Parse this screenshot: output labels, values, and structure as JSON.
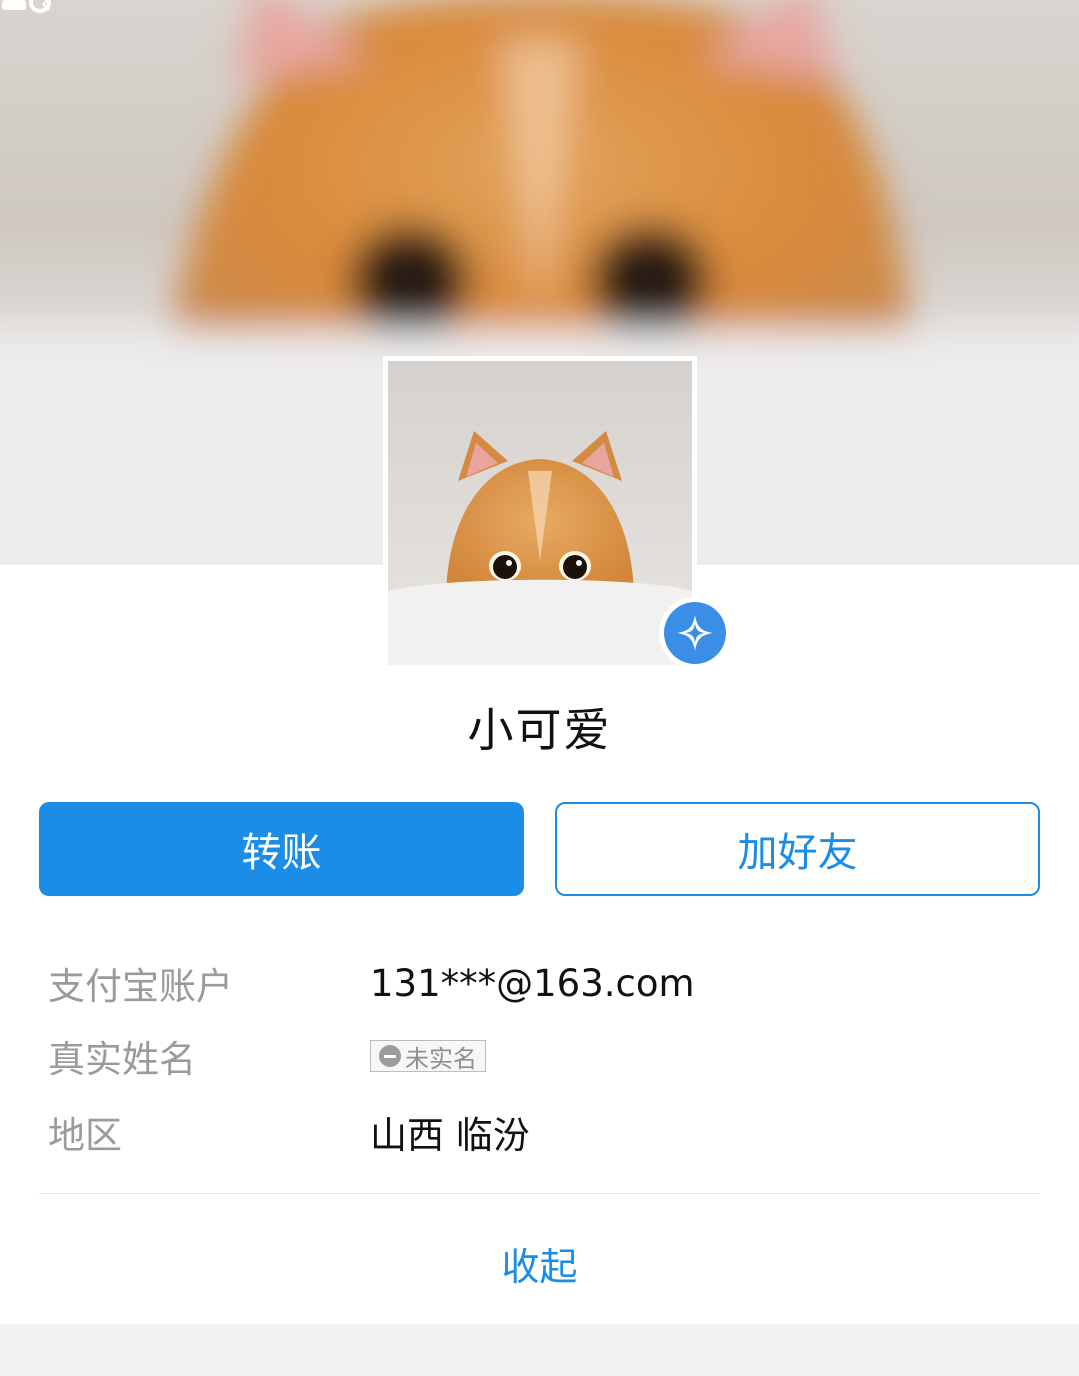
{
  "topbar": {
    "back_icon": "chevron-left-icon",
    "settings_icon": "user-settings-icon"
  },
  "profile": {
    "nickname": "小可爱",
    "badge_icon": "star-badge-icon"
  },
  "actions": {
    "transfer_label": "转账",
    "add_friend_label": "加好友"
  },
  "info": [
    {
      "label": "支付宝账户",
      "value": "131***@163.com"
    },
    {
      "label": "真实姓名",
      "tag": "未实名"
    },
    {
      "label": "地区",
      "value": "山西 临汾"
    }
  ],
  "collapse_label": "收起",
  "colors": {
    "accent": "#1b8de7",
    "badge": "#3a8ee6"
  }
}
